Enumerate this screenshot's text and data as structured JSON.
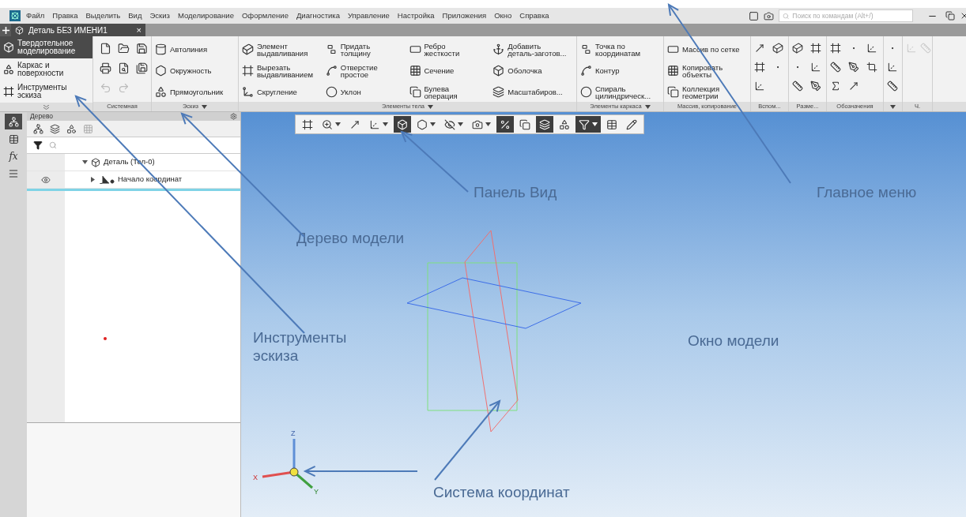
{
  "menu": {
    "items": [
      "Файл",
      "Правка",
      "Выделить",
      "Вид",
      "Эскиз",
      "Моделирование",
      "Оформление",
      "Диагностика",
      "Управление",
      "Настройка",
      "Приложения",
      "Окно",
      "Справка"
    ],
    "search": {
      "placeholder": "Поиск по командам (Alt+/)"
    }
  },
  "document_tab": {
    "title": "Деталь БЕЗ ИМЕНИ1",
    "close": "×"
  },
  "ribbon": {
    "modes": [
      {
        "label": "Твердотельное\nмоделирование",
        "selected": true
      },
      {
        "label": "Каркас и\nповерхности",
        "selected": false
      },
      {
        "label": "Инструменты\nэскиза",
        "selected": false
      }
    ],
    "groups": [
      {
        "kind": "system",
        "label": "Системная",
        "dropdown": false
      },
      {
        "kind": "commands",
        "label": "Эскиз",
        "dropdown": true,
        "columns": [
          [
            "Автолиния",
            "Окружность",
            "Прямоугольник"
          ]
        ]
      },
      {
        "kind": "commands",
        "label": "Элементы тела",
        "dropdown": true,
        "columns": [
          [
            "Элемент\nвыдавливания",
            "Вырезать\nвыдавливанием",
            "Скругление"
          ],
          [
            "Придать\nтолщину",
            "Отверстие\nпростое",
            "Уклон"
          ],
          [
            "Ребро\nжесткости",
            "Сечение",
            "Булева\nоперация"
          ],
          [
            "Добавить\nдеталь-заготов...",
            "Оболочка",
            "Масштабиров..."
          ]
        ]
      },
      {
        "kind": "commands",
        "label": "Элементы каркаса",
        "dropdown": true,
        "columns": [
          [
            "Точка по\nкоординатам",
            "Контур",
            "Спираль\nцилиндрическ..."
          ]
        ]
      },
      {
        "kind": "commands",
        "label": "Массив, копирование",
        "dropdown": false,
        "columns": [
          [
            "Массив по сетке",
            "Копировать\nобъекты",
            "Коллекция\nгеометрии"
          ]
        ]
      },
      {
        "kind": "icons",
        "label": "Вспом...",
        "dropdown": false
      },
      {
        "kind": "icons",
        "label": "Разме...",
        "dropdown": false
      },
      {
        "kind": "icons",
        "label": "Обозначения",
        "dropdown": false
      },
      {
        "kind": "icons",
        "dropdown": true
      },
      {
        "kind": "icons",
        "label": "Ч.",
        "dropdown": false
      }
    ]
  },
  "sidebar_tabs": [
    {
      "kind": "tree",
      "selected": true
    },
    {
      "kind": "table",
      "selected": false
    },
    {
      "kind": "formula",
      "label": "fx",
      "selected": false
    },
    {
      "kind": "menu",
      "selected": false
    }
  ],
  "tree_panel": {
    "title": "Дерево",
    "rows": [
      {
        "label": "Деталь (Тел-0)",
        "expanded": true,
        "visible": false,
        "children": [
          {
            "label": "Начало координат",
            "expanded": false,
            "visible": true
          }
        ]
      }
    ]
  },
  "view_toolbar": [
    {
      "on": false,
      "dropdown": false
    },
    {
      "on": false,
      "dropdown": true
    },
    {
      "on": false,
      "dropdown": false
    },
    {
      "on": false,
      "dropdown": true
    },
    {
      "on": true,
      "dropdown": false
    },
    {
      "on": false,
      "dropdown": true
    },
    {
      "on": false,
      "dropdown": true
    },
    {
      "on": false,
      "dropdown": true
    },
    {
      "on": true,
      "dropdown": false
    },
    {
      "on": false,
      "dropdown": false
    },
    {
      "on": true,
      "dropdown": false
    },
    {
      "on": false,
      "dropdown": false
    },
    {
      "on": true,
      "dropdown": true
    },
    {
      "on": false,
      "dropdown": false
    },
    {
      "on": false,
      "dropdown": false
    }
  ],
  "axes": [
    "Z",
    "X",
    "Y"
  ],
  "annotations": [
    {
      "text": "Панель Вид"
    },
    {
      "text": "Главное меню"
    },
    {
      "text": "Дерево модели"
    },
    {
      "text": "Инструменты\nэскиза"
    },
    {
      "text": "Окно модели"
    },
    {
      "text": "Система координат"
    }
  ]
}
